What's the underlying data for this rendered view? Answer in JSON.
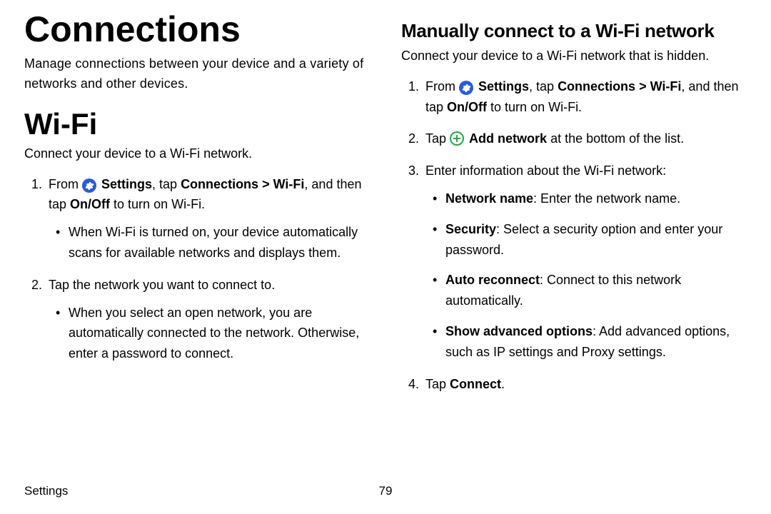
{
  "left": {
    "title": "Connections",
    "intro": "Manage connections between your device and a variety of networks and other devices.",
    "wifi": {
      "heading": "Wi-Fi",
      "lead": "Connect your device to a Wi-Fi network.",
      "step1": {
        "pre": "From ",
        "settings": "Settings",
        "mid1": ", tap ",
        "connections": "Connections",
        "gt": " > ",
        "wifi": "Wi-Fi",
        "mid2": ", and then tap ",
        "onoff": "On/Off",
        "post": " to turn on Wi-Fi.",
        "sub1": "When Wi-Fi is turned on, your device automatically scans for available networks and displays them."
      },
      "step2": {
        "text": "Tap the network you want to connect to.",
        "sub1": "When you select an open network, you are automatically connected to the network. Otherwise, enter a password to connect."
      }
    }
  },
  "right": {
    "heading": "Manually connect to a Wi-Fi network",
    "lead": "Connect your device to a Wi-Fi network that is hidden.",
    "step1": {
      "pre": "From ",
      "settings": "Settings",
      "mid1": ", tap ",
      "connections": "Connections",
      "gt": " > ",
      "wifi": "Wi-Fi",
      "mid2": ", and then tap ",
      "onoff": "On/Off",
      "post": " to turn on Wi-Fi."
    },
    "step2": {
      "pre": "Tap ",
      "addnet": "Add network",
      "post": " at the bottom of the list."
    },
    "step3": {
      "text": "Enter information about the Wi-Fi network:",
      "sub1": {
        "label": "Network name",
        "text": ": Enter the network name."
      },
      "sub2": {
        "label": "Security",
        "text": ": Select a security option and enter your password."
      },
      "sub3": {
        "label": "Auto reconnect",
        "text": ": Connect to this network automatically."
      },
      "sub4": {
        "label": "Show advanced options",
        "text": ": Add advanced options, such as IP settings and Proxy settings."
      }
    },
    "step4": {
      "pre": "Tap ",
      "connect": "Connect",
      "post": "."
    }
  },
  "footer": {
    "section": "Settings",
    "page": "79"
  }
}
